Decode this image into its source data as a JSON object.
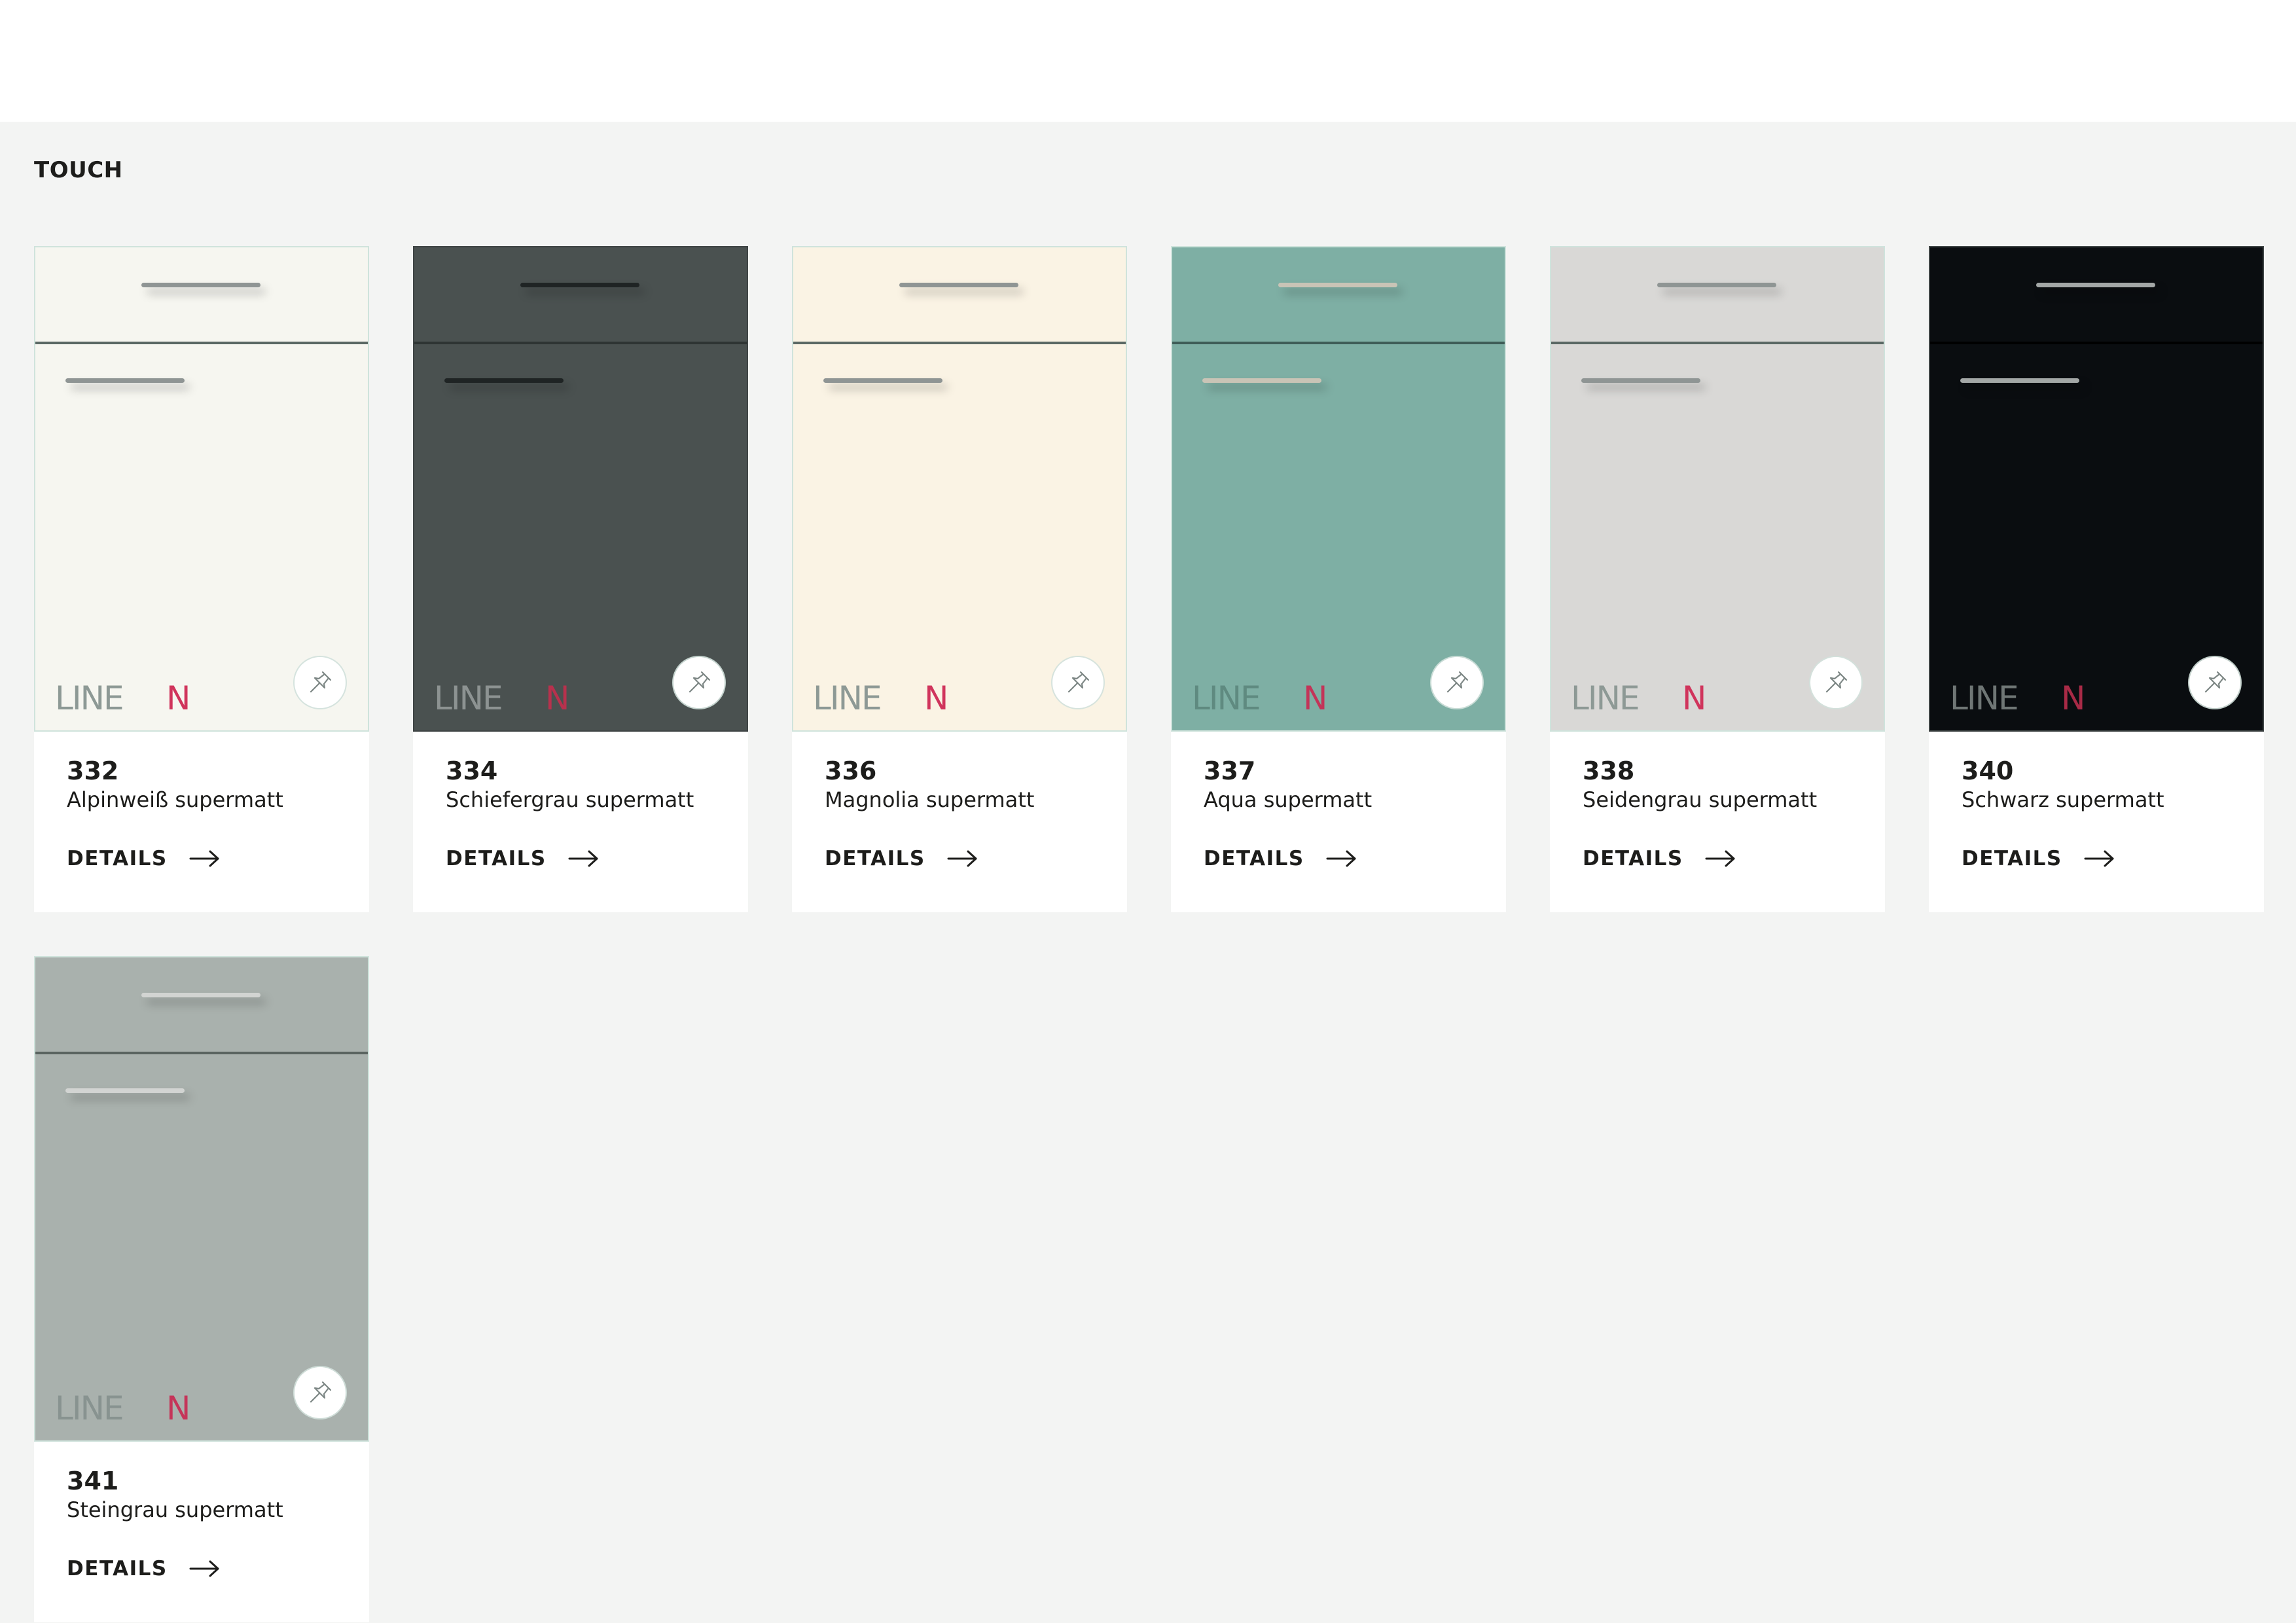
{
  "section": {
    "title": "TOUCH"
  },
  "products": [
    {
      "code": "332",
      "name": "Alpinweiß supermatt",
      "details_label": "DETAILS",
      "color": "#f6f6f0",
      "line_color": "#5a6864",
      "handle_color": "#8f9594",
      "logo_text_color": "#8d9995",
      "logo_accent": "#d0345c",
      "dark": false
    },
    {
      "code": "334",
      "name": "Schiefergrau supermatt",
      "details_label": "DETAILS",
      "color": "#4a5150",
      "line_color": "#2e3433",
      "handle_color": "#1f2424",
      "logo_text_color": "#8d9392",
      "logo_accent": "#b8314d",
      "dark": true
    },
    {
      "code": "336",
      "name": "Magnolia supermatt",
      "details_label": "DETAILS",
      "color": "#faf3e4",
      "line_color": "#5a6864",
      "handle_color": "#8f9594",
      "logo_text_color": "#8d9995",
      "logo_accent": "#d0345c",
      "dark": false
    },
    {
      "code": "337",
      "name": "Aqua supermatt",
      "details_label": "DETAILS",
      "color": "#7eafa4",
      "line_color": "#3f5d57",
      "handle_color": "#c9c4b6",
      "logo_text_color": "#5f8a80",
      "logo_accent": "#c33458",
      "dark": false
    },
    {
      "code": "338",
      "name": "Seidengrau supermatt",
      "details_label": "DETAILS",
      "color": "#d9d8d6",
      "line_color": "#5a6864",
      "handle_color": "#8f9594",
      "logo_text_color": "#8d9995",
      "logo_accent": "#d0345c",
      "dark": false
    },
    {
      "code": "340",
      "name": "Schwarz supermatt",
      "details_label": "DETAILS",
      "color": "#0a0d10",
      "line_color": "#000000",
      "handle_color": "#a3a7a6",
      "logo_text_color": "#6f7675",
      "logo_accent": "#a82a46",
      "dark": true
    },
    {
      "code": "341",
      "name": "Steingrau supermatt",
      "details_label": "DETAILS",
      "color": "#a9b1ad",
      "line_color": "#5a6460",
      "handle_color": "#d2d4d2",
      "logo_text_color": "#889390",
      "logo_accent": "#c53459",
      "dark": false
    }
  ],
  "logo": {
    "text_line": "LINE",
    "text_accent": "N"
  },
  "icons": {
    "pin": "pushpin-icon",
    "arrow": "arrow-right-icon"
  }
}
